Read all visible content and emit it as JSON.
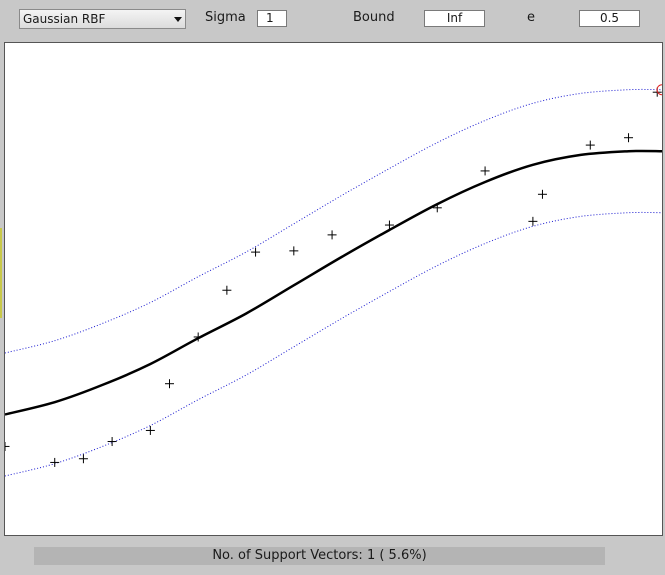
{
  "toolbar": {
    "kernel_select": {
      "selected": "Gaussian RBF"
    },
    "sigma": {
      "label": "Sigma",
      "value": "1"
    },
    "bound": {
      "label": "Bound",
      "value": "Inf"
    },
    "epsilon": {
      "label": "e",
      "value": "0.5"
    }
  },
  "plot": {
    "points": [
      [
        -0.52,
        -0.08
      ],
      [
        0.0,
        -0.21
      ],
      [
        0.3,
        -0.18
      ],
      [
        0.6,
        -0.04
      ],
      [
        1.0,
        0.05
      ],
      [
        1.2,
        0.43
      ],
      [
        1.5,
        0.81
      ],
      [
        1.8,
        1.19
      ],
      [
        2.1,
        1.5
      ],
      [
        2.5,
        1.51
      ],
      [
        2.9,
        1.64
      ],
      [
        3.5,
        1.72
      ],
      [
        4.0,
        1.86
      ],
      [
        4.5,
        2.16
      ],
      [
        5.0,
        1.75
      ],
      [
        5.1,
        1.97
      ],
      [
        5.6,
        2.37
      ],
      [
        6.0,
        2.43
      ],
      [
        6.3,
        2.8
      ]
    ],
    "regression_curve": [
      [
        -0.52,
        0.18
      ],
      [
        0.0,
        0.28
      ],
      [
        0.5,
        0.42
      ],
      [
        1.0,
        0.59
      ],
      [
        1.5,
        0.8
      ],
      [
        2.0,
        1.0
      ],
      [
        2.5,
        1.23
      ],
      [
        3.0,
        1.46
      ],
      [
        3.5,
        1.68
      ],
      [
        4.0,
        1.89
      ],
      [
        4.5,
        2.07
      ],
      [
        5.0,
        2.21
      ],
      [
        5.5,
        2.29
      ],
      [
        6.0,
        2.32
      ],
      [
        6.35,
        2.32
      ]
    ],
    "epsilon": 0.5,
    "support_vectors": [
      [
        6.35,
        2.82
      ]
    ],
    "colors": {
      "curve": "#000000",
      "tube": "#1a1ad0",
      "marker": "#000000",
      "support_vector": "#e02020"
    }
  },
  "status": {
    "text": "No. of Support Vectors: 1 ( 5.6%)"
  }
}
